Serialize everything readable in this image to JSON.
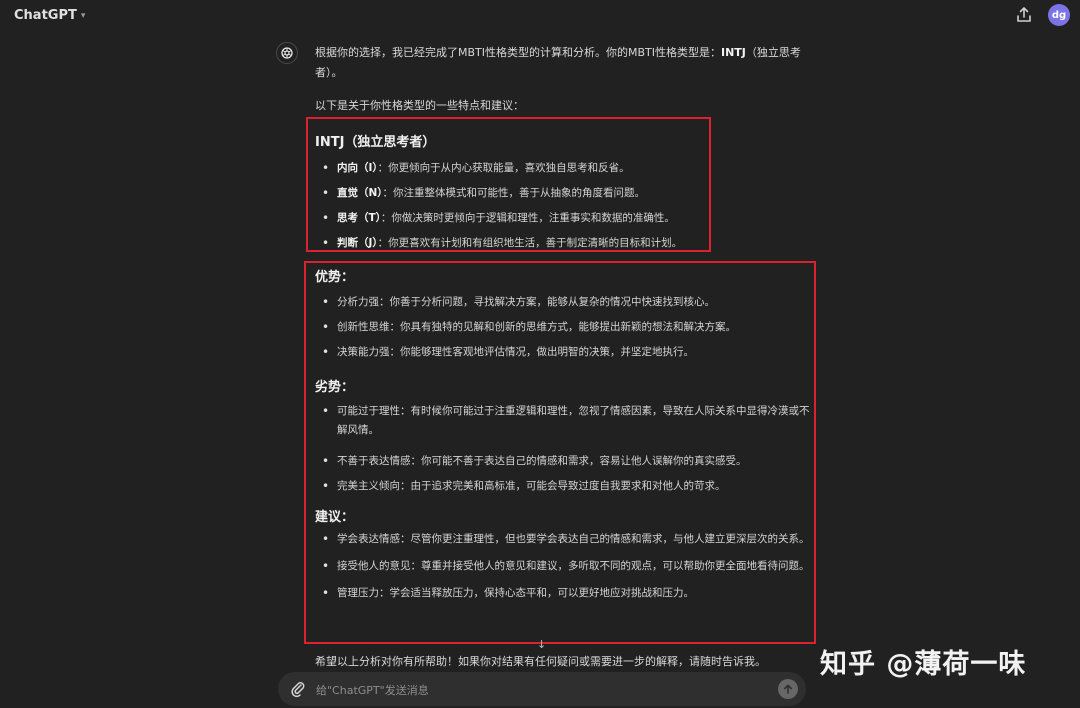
{
  "header": {
    "app_title": "ChatGPT",
    "avatar_initials": "dg"
  },
  "message": {
    "intro_a": "根据你的选择，我已经完成了MBTI性格类型的计算和分析。你的MBTI性格类型是：",
    "intro_type": "INTJ",
    "intro_b": "（独立思考者）。",
    "subheading": "以下是关于你性格类型的一些特点和建议：",
    "type_section": {
      "title": "INTJ（独立思考者）",
      "items": [
        {
          "term": "内向（I）",
          "text": "：你更倾向于从内心获取能量，喜欢独自思考和反省。"
        },
        {
          "term": "直觉（N）",
          "text": "：你注重整体模式和可能性，善于从抽象的角度看问题。"
        },
        {
          "term": "思考（T）",
          "text": "：你做决策时更倾向于逻辑和理性，注重事实和数据的准确性。"
        },
        {
          "term": "判断（J）",
          "text": "：你更喜欢有计划和有组织地生活，善于制定清晰的目标和计划。"
        }
      ]
    },
    "strengths": {
      "title": "优势：",
      "items": [
        "分析力强：你善于分析问题，寻找解决方案，能够从复杂的情况中快速找到核心。",
        "创新性思维：你具有独特的见解和创新的思维方式，能够提出新颖的想法和解决方案。",
        "决策能力强：你能够理性客观地评估情况，做出明智的决策，并坚定地执行。"
      ]
    },
    "weaknesses": {
      "title": "劣势：",
      "items": [
        "可能过于理性：有时候你可能过于注重逻辑和理性，忽视了情感因素，导致在人际关系中显得冷漠或不解风情。",
        "不善于表达情感：你可能不善于表达自己的情感和需求，容易让他人误解你的真实感受。",
        "完美主义倾向：由于追求完美和高标准，可能会导致过度自我要求和对他人的苛求。"
      ]
    },
    "advice": {
      "title": "建议：",
      "items": [
        "学会表达情感：尽管你更注重理性，但也要学会表达自己的情感和需求，与他人建立更深层次的关系。",
        "接受他人的意见：尊重并接受他人的意见和建议，多听取不同的观点，可以帮助你更全面地看待问题。",
        "管理压力：学会适当释放压力，保持心态平和，可以更好地应对挑战和压力。"
      ]
    },
    "closing": "希望以上分析对你有所帮助！如果你对结果有任何疑问或需要进一步的解释，请随时告诉我。"
  },
  "composer": {
    "placeholder": "给\"ChatGPT\"发送消息"
  },
  "watermark": "知乎 @薄荷一味",
  "colors": {
    "background": "#212121",
    "highlight_box": "#d9232d",
    "avatar": "#7c73e6"
  },
  "icons": {
    "share": "share-icon",
    "logo": "openai-logo-icon",
    "attach": "paperclip-icon",
    "send": "arrow-up-icon",
    "scroll": "arrow-down-icon"
  }
}
